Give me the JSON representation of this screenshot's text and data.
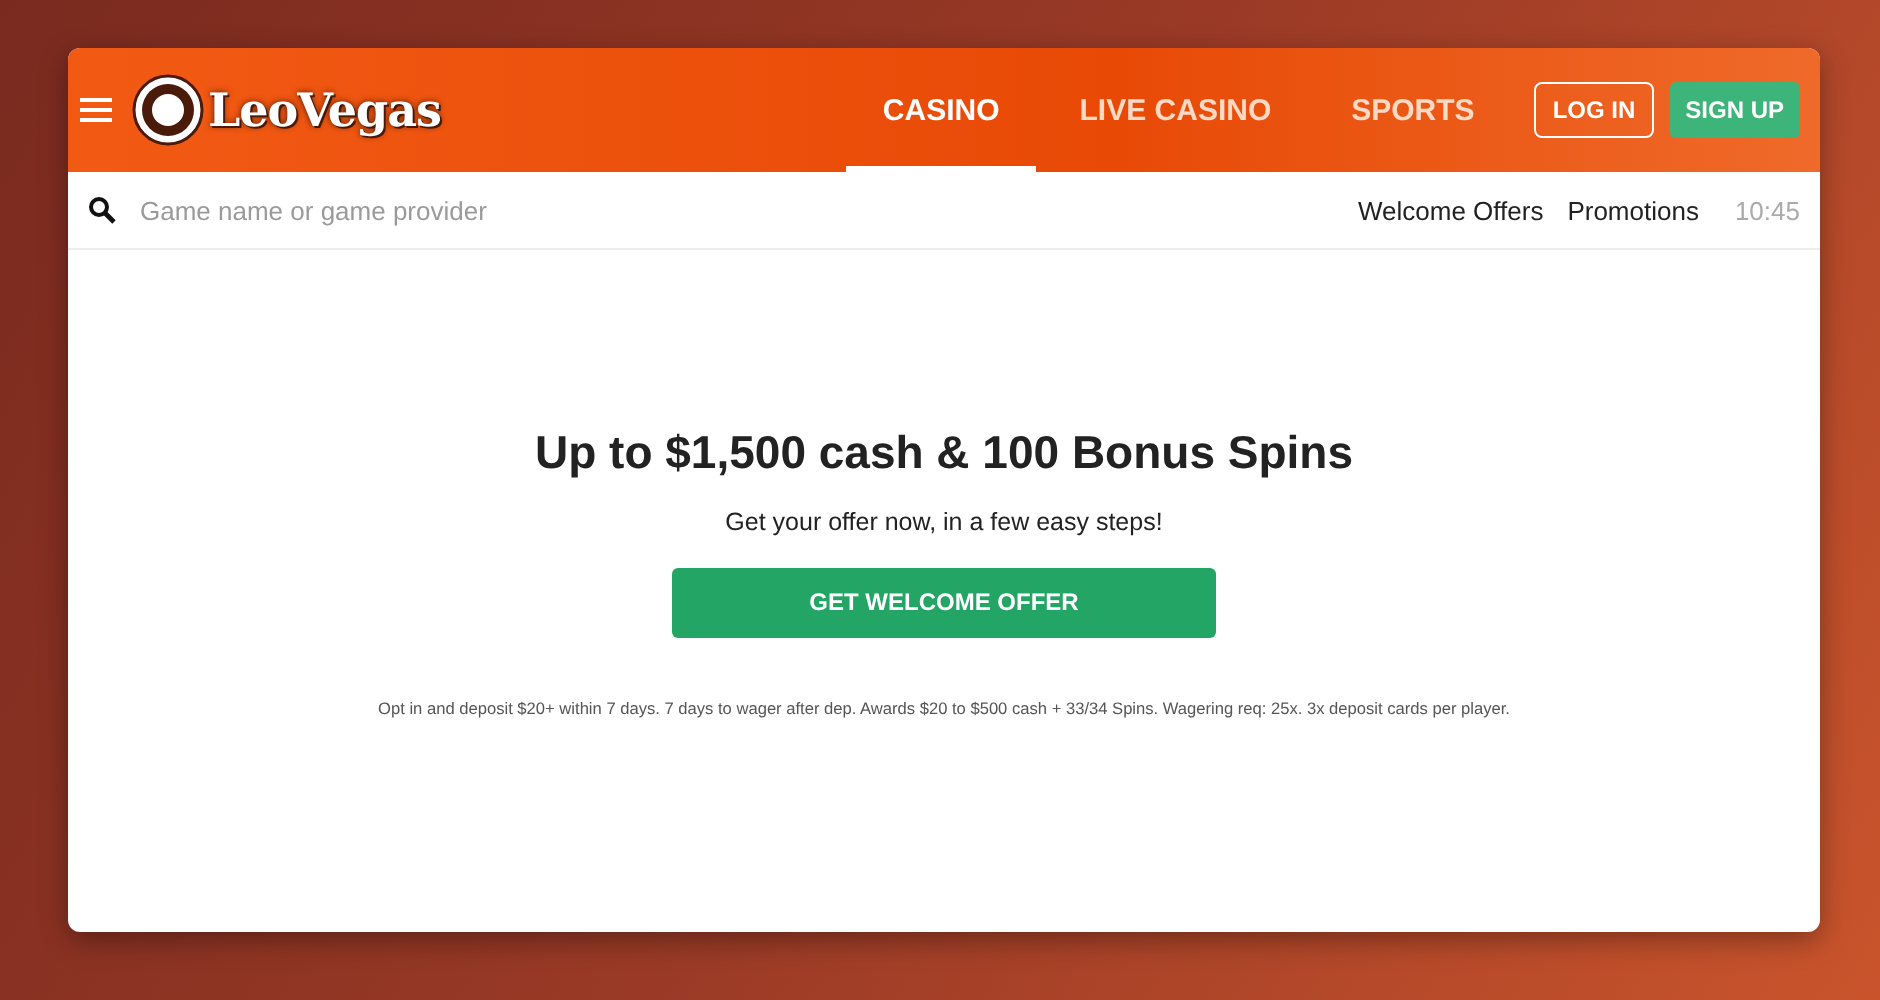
{
  "header": {
    "logo": "LeoVegas",
    "tabs": [
      {
        "label": "CASINO",
        "selected": true
      },
      {
        "label": "LIVE CASINO",
        "selected": false
      },
      {
        "label": "SPORTS",
        "selected": false
      }
    ],
    "login": "LOG IN",
    "signup": "SIGN UP"
  },
  "search": {
    "placeholder": "Game name or game provider",
    "links": [
      "Welcome Offers",
      "Promotions"
    ],
    "time": "10:45"
  },
  "offer": {
    "title": "Up to $1,500 cash & 100 Bonus Spins",
    "subtitle": "Get your offer now, in a few easy steps!",
    "button": "GET WELCOME OFFER",
    "terms": "Opt in and deposit $20+ within 7 days. 7 days to wager after dep. Awards $20 to $500 cash + 33/34 Spins. Wagering req: 25x. 3x deposit cards per player."
  }
}
